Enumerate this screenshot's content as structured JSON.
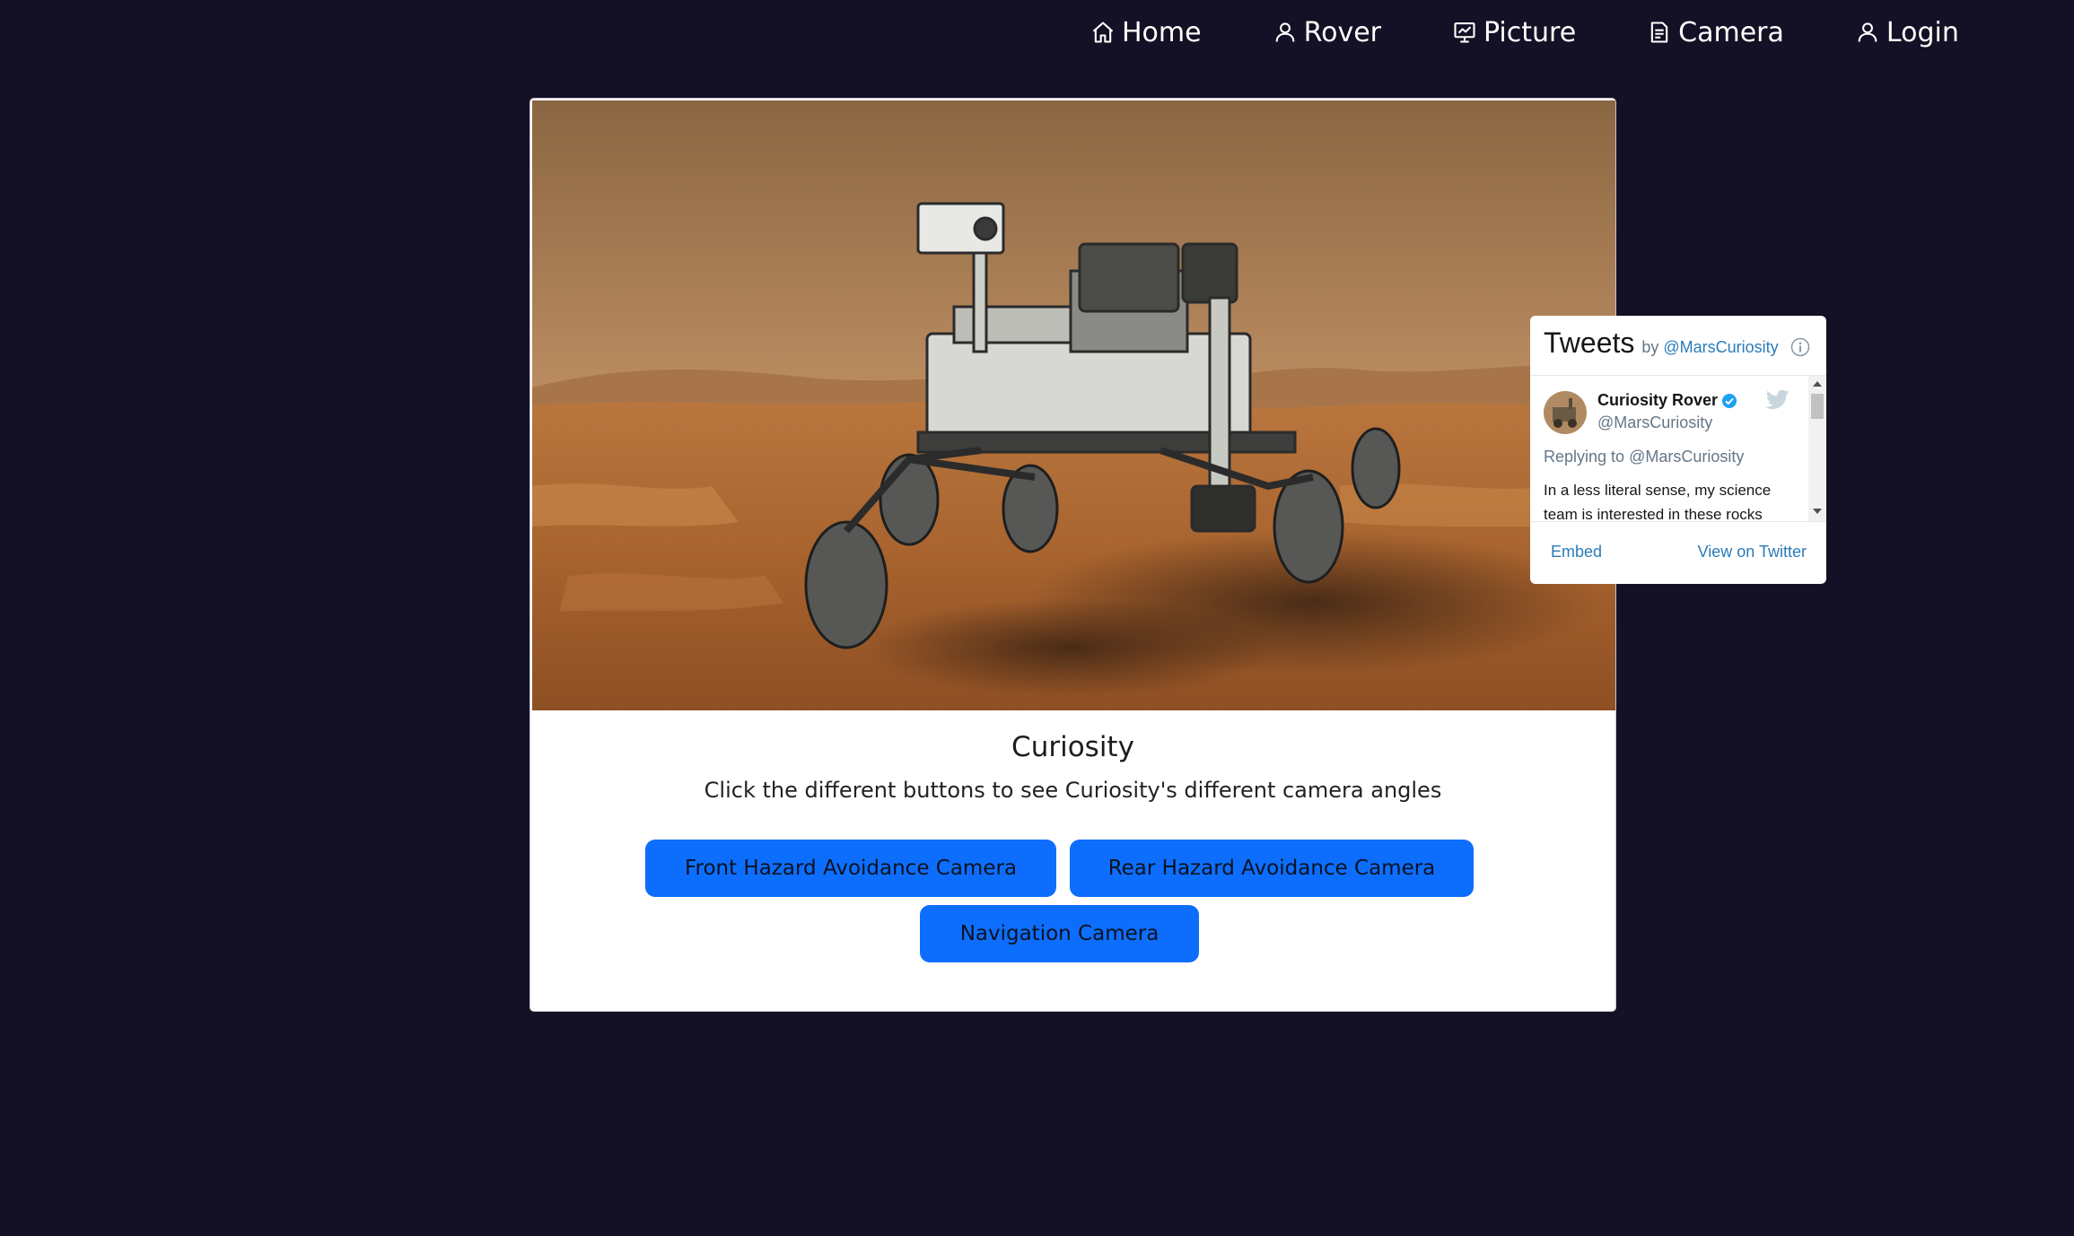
{
  "nav": {
    "items": [
      {
        "label": "Home",
        "icon": "home-icon"
      },
      {
        "label": "Rover",
        "icon": "user-icon"
      },
      {
        "label": "Picture",
        "icon": "chart-board-icon"
      },
      {
        "label": "Camera",
        "icon": "document-icon"
      },
      {
        "label": "Login",
        "icon": "user-icon"
      }
    ]
  },
  "card": {
    "image_alt": "Mars rover on the Martian surface",
    "title": "Curiosity",
    "subtitle": "Click the different buttons to see Curiosity's different camera angles",
    "buttons": {
      "front": "Front Hazard Avoidance Camera",
      "rear": "Rear Hazard Avoidance Camera",
      "navigation": "Navigation Camera"
    },
    "button_color": "#0d6efd"
  },
  "twitter": {
    "title": "Tweets",
    "by": "by",
    "handle": "@MarsCuriosity",
    "tweet": {
      "name": "Curiosity Rover",
      "username": "@MarsCuriosity",
      "reply_prefix": "Replying to",
      "reply_to": "@MarsCuriosity",
      "text": "In a less literal sense, my science team is interested in these rocks"
    },
    "embed": "Embed",
    "view_on_twitter": "View on Twitter",
    "link_color": "#2b7bb9"
  },
  "colors": {
    "background": "#141025",
    "card": "#ffffff"
  }
}
